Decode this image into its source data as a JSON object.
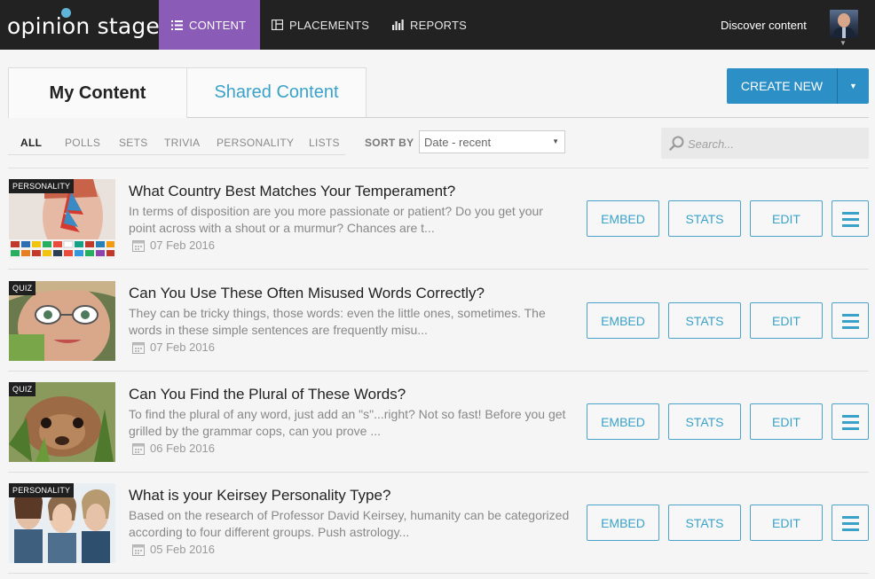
{
  "nav": {
    "logo": "opinion stage",
    "items": [
      {
        "label": "CONTENT",
        "icon": "list-icon"
      },
      {
        "label": "PLACEMENTS",
        "icon": "layout-icon"
      },
      {
        "label": "REPORTS",
        "icon": "bar-chart-icon"
      }
    ],
    "discover": "Discover content"
  },
  "tabs": {
    "my": "My Content",
    "shared": "Shared Content"
  },
  "create": {
    "label": "CREATE NEW"
  },
  "filters": [
    "ALL",
    "POLLS",
    "SETS",
    "TRIVIA",
    "PERSONALITY",
    "LISTS"
  ],
  "sort": {
    "label": "SORT BY",
    "value": "Date - recent"
  },
  "search": {
    "placeholder": "Search..."
  },
  "actions": {
    "embed": "EMBED",
    "stats": "STATS",
    "edit": "EDIT"
  },
  "items": [
    {
      "badge": "PERSONALITY",
      "title": "What Country Best Matches Your Temperament?",
      "desc": "In terms of disposition are you more passionate or patient? Do you get your point across with a shout or a murmur? Chances are t...",
      "date": "07 Feb 2016"
    },
    {
      "badge": "QUIZ",
      "title": "Can You Use These Often Misused Words Correctly?",
      "desc": "They can be tricky things, those words: even the little ones, sometimes. The words in these simple sentences are frequently misu...",
      "date": "07 Feb 2016"
    },
    {
      "badge": "QUIZ",
      "title": "Can You Find the Plural of These Words?",
      "desc": "To find the plural of any word, just add an \"s\"...right? Not so fast! Before you get grilled by the grammar cops, can you prove ...",
      "date": "06 Feb 2016"
    },
    {
      "badge": "PERSONALITY",
      "title": "What is your Keirsey Personality Type?",
      "desc": "Based on the research of Professor David Keirsey, humanity can be categorized according to four different groups. Push astrology...",
      "date": "05 Feb 2016"
    }
  ]
}
